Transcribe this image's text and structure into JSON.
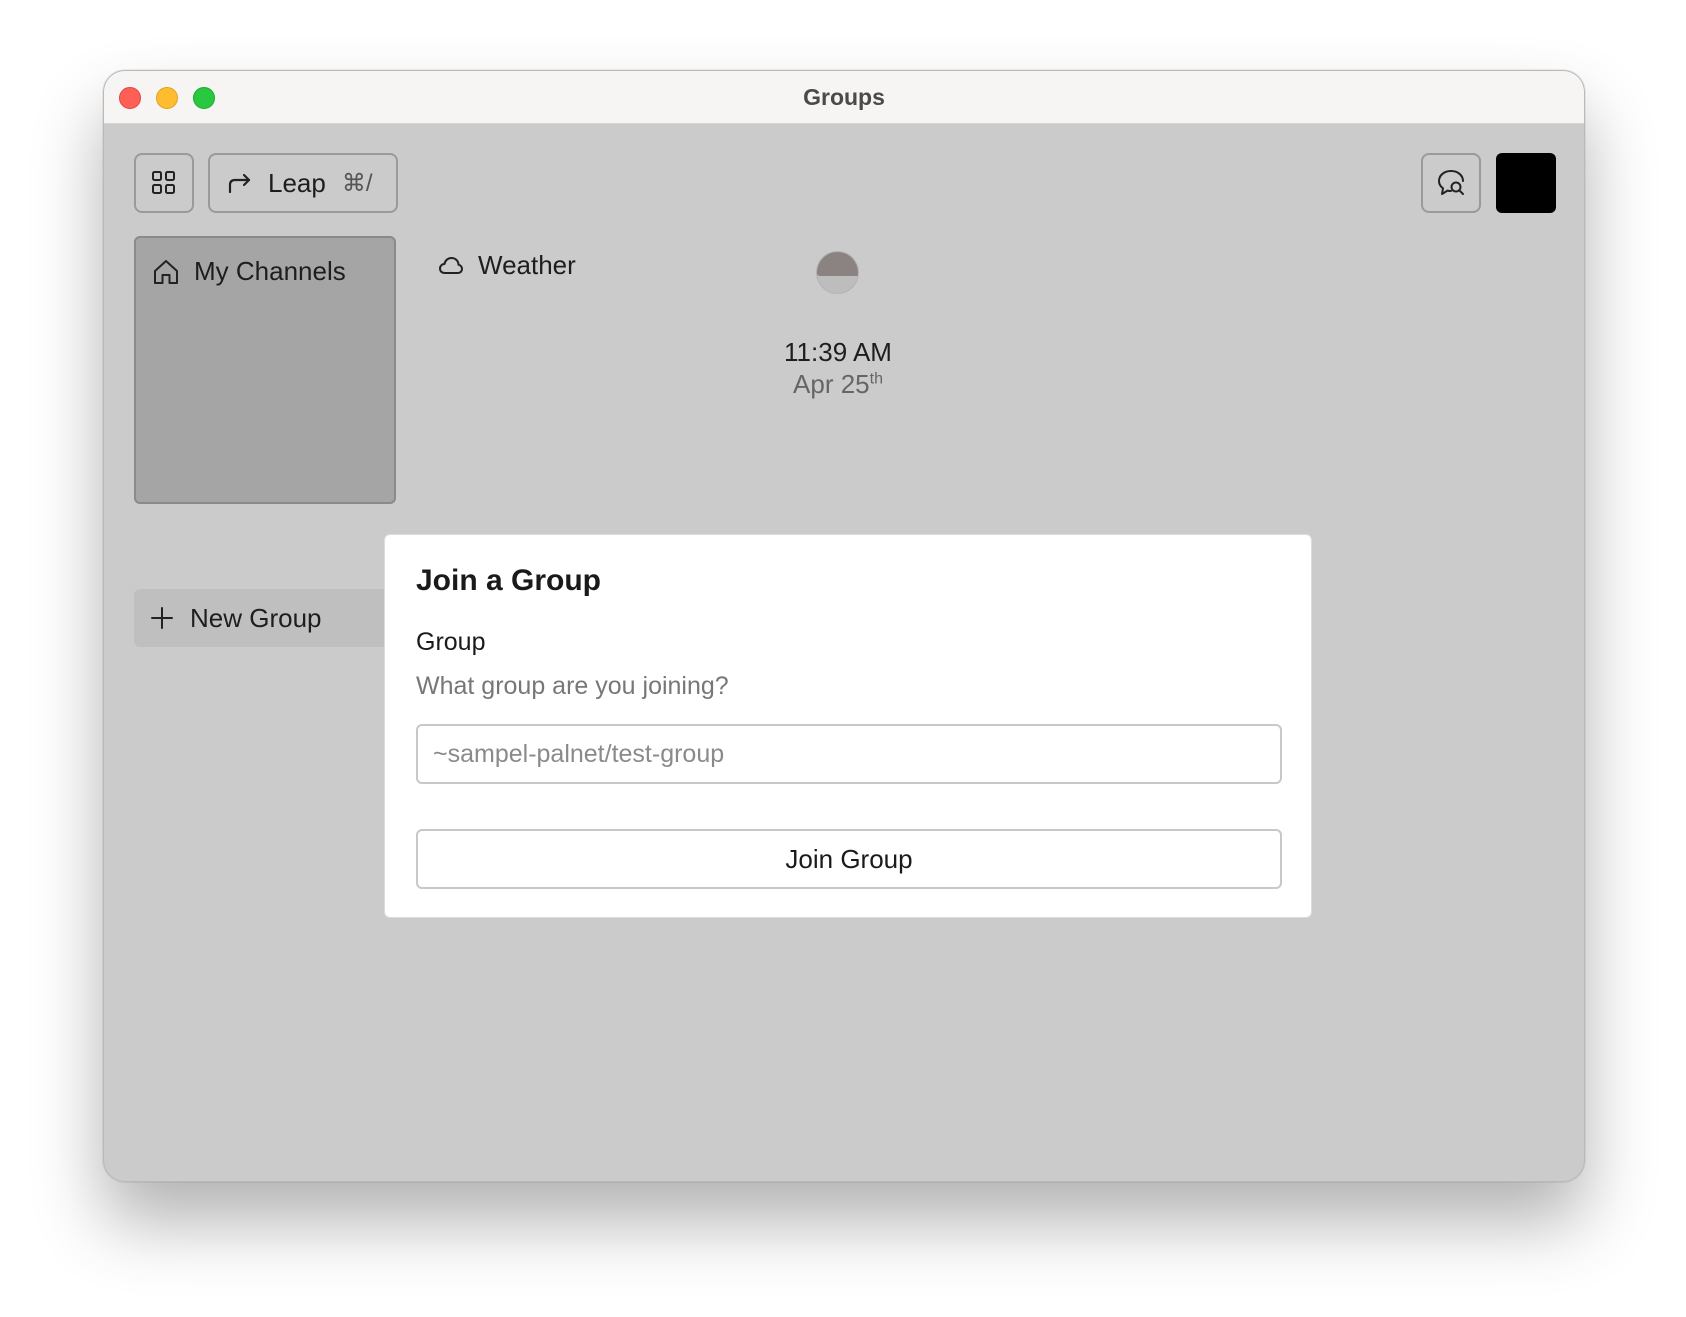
{
  "window": {
    "title": "Groups"
  },
  "toolbar": {
    "apps_icon": "grid-icon",
    "leap": {
      "icon": "redirect-arrow-icon",
      "label": "Leap",
      "shortcut": "⌘/"
    },
    "notifications_icon": "chat-search-icon"
  },
  "tiles": {
    "my_channels": {
      "icon": "home-icon",
      "label": "My Channels"
    },
    "weather": {
      "icon": "cloud-icon",
      "label": "Weather"
    }
  },
  "clock": {
    "time": "11:39 AM",
    "date": "Apr 25",
    "date_suffix": "th"
  },
  "sidebar": {
    "new_group": {
      "icon": "plus-icon",
      "label": "New Group"
    }
  },
  "modal": {
    "title": "Join a Group",
    "field_label": "Group",
    "field_help": "What group are you joining?",
    "input_value": "",
    "input_placeholder": "~sampel-palnet/test-group",
    "submit_label": "Join Group"
  },
  "colors": {
    "background": "#cbcbcb",
    "tile": "#a5a5a5",
    "modal": "#ffffff",
    "close": "#ff5f57",
    "minimize": "#febc2e",
    "maximize": "#28c840"
  }
}
